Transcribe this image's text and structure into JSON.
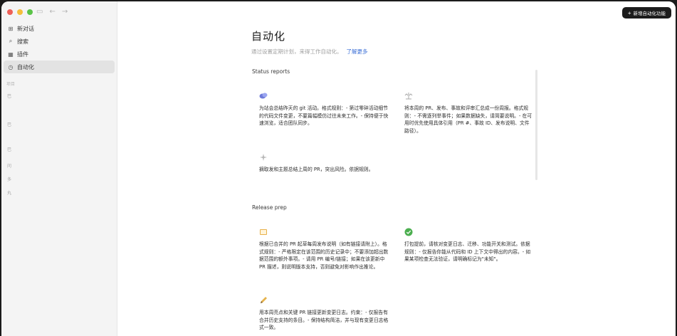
{
  "sidebar": {
    "nav": [
      {
        "icon": "new-chat-icon",
        "label": "新对话"
      },
      {
        "icon": "search-icon",
        "label": "搜索"
      },
      {
        "icon": "plugins-icon",
        "label": "插件"
      },
      {
        "icon": "clock-icon",
        "label": "自动化"
      }
    ],
    "section_label": "项目",
    "fragments": [
      "巴",
      "巴",
      "巴",
      "问",
      "多",
      "丸"
    ]
  },
  "header": {
    "new_automation_button": "新增自动化功能"
  },
  "main": {
    "title": "自动化",
    "subtitle": "通过设置定期计划，来得工作自动化。",
    "learn_more": "了解更多",
    "groups": [
      {
        "title": "Status reports",
        "cards": [
          {
            "icon": "chat-bubbles-icon",
            "text": "为站会总结昨天的 git 活动。格式规则：- 第过零碎活动细节的代码文件变更，不要篇幅模仿过往未来工作。- 保持便于快速浏览，适合团队同步。"
          },
          {
            "icon": "scales-icon",
            "text": "将本周的 PR、发布、事故和评审汇总成一份周报。格式规则：- 不需逐列举事件；如果数据缺失，请简要说明。- 在可用时优先使用具体引用（PR #、事故 ID、发布说明、文件路径）。"
          },
          {
            "icon": "sparkle-icon",
            "text": "摘取发和主题总结上周的 PR，突出风险。依据规则。"
          }
        ]
      },
      {
        "title": "Release prep",
        "cards": [
          {
            "icon": "book-icon",
            "text": "根据已合并的 PR 起草每周发布说明（如有链接请附上）。格式规则：- 严格限定在该范围的历史记录中；不要添加超出数据范围的额外事项。- 请用 PR 编号/链接；如果在该更新中 PR 描述，则说明版本支持，否则避免对影响作出推论。"
          },
          {
            "icon": "check-circle-icon",
            "text": "打包提前，请核对变更日志、迁移、功能开关和测试。依据规则：- 仅报告你能从代码和 ID 上下文中得出的内容。- 如果某项检查无法验证，请明确标记为\"未知\"。"
          },
          {
            "icon": "pencil-icon",
            "text": "用本周亮点和关键 PR 链接更新变更日志。约束：- 仅报告有合并历史支持的条目。- 保持结构简洁，并与现有变更日志格式一致。"
          }
        ]
      }
    ]
  }
}
